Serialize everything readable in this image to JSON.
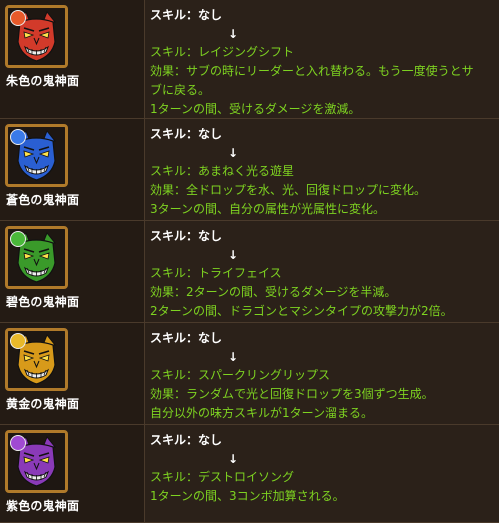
{
  "rows": [
    {
      "name": "朱色の鬼神面",
      "color": "#d23a2a",
      "badge_color": "#e85a2a",
      "before_skill": "スキル：なし",
      "arrow": "↓",
      "after_lines": [
        "スキル：レイジングシフト",
        "効果：サブの時にリーダーと入れ替わる。もう一度使うとサ",
        "ブに戻る。",
        "1ターンの間、受けるダメージを激減。"
      ]
    },
    {
      "name": "蒼色の鬼神面",
      "color": "#2a5fd2",
      "badge_color": "#3a7ae8",
      "before_skill": "スキル：なし",
      "arrow": "↓",
      "after_lines": [
        "スキル：あまねく光る遊星",
        "効果：全ドロップを水、光、回復ドロップに変化。",
        "3ターンの間、自分の属性が光属性に変化。"
      ]
    },
    {
      "name": "碧色の鬼神面",
      "color": "#3a9a2a",
      "badge_color": "#4ab83a",
      "before_skill": "スキル：なし",
      "arrow": "↓",
      "after_lines": [
        "スキル：トライフェイス",
        "効果：2ターンの間、受けるダメージを半減。",
        "2ターンの間、ドラゴンとマシンタイプの攻撃力が2倍。"
      ]
    },
    {
      "name": "黄金の鬼神面",
      "color": "#d89a1a",
      "badge_color": "#e8b82a",
      "before_skill": "スキル：なし",
      "arrow": "↓",
      "after_lines": [
        "スキル：スパークリングリップス",
        "効果：ランダムで光と回復ドロップを3個ずつ生成。",
        "自分以外の味方スキルが1ターン溜まる。"
      ]
    },
    {
      "name": "紫色の鬼神面",
      "color": "#8a3ab8",
      "badge_color": "#a04ad2",
      "before_skill": "スキル：なし",
      "arrow": "↓",
      "after_lines": [
        "スキル：デストロイソング",
        "1ターンの間、3コンボ加算される。"
      ]
    }
  ]
}
